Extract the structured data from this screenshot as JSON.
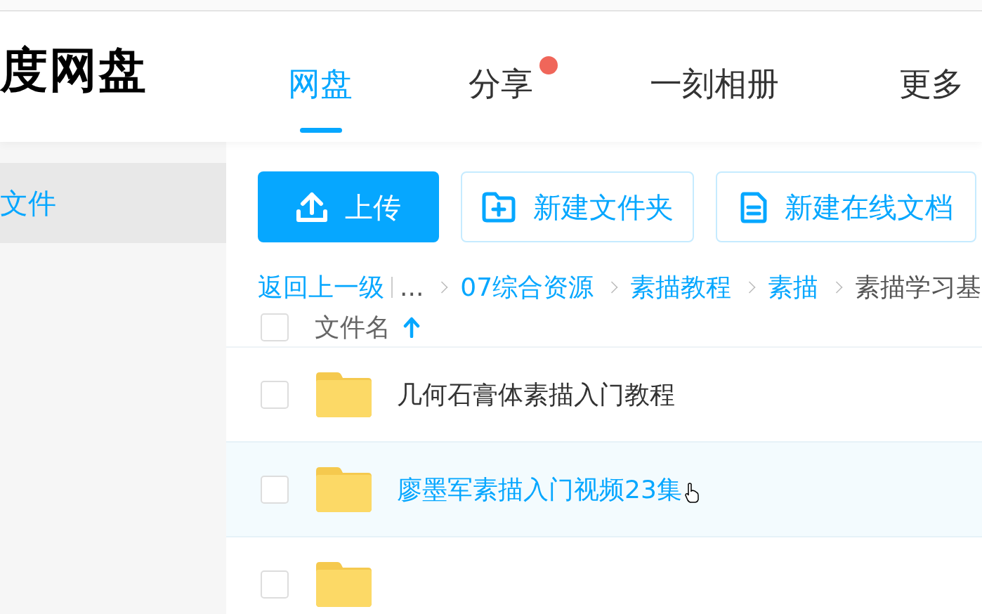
{
  "logo": "度网盘",
  "nav_tabs": [
    {
      "label": "网盘",
      "selected": true,
      "badge": false
    },
    {
      "label": "分享",
      "selected": false,
      "badge": true
    },
    {
      "label": "一刻相册",
      "selected": false,
      "badge": false
    },
    {
      "label": "更多",
      "selected": false,
      "badge": false
    }
  ],
  "sidebar": {
    "items": [
      {
        "label": "文件",
        "selected": true
      }
    ]
  },
  "toolbar": {
    "buttons": [
      {
        "kind": "upload",
        "label": "上传"
      },
      {
        "kind": "new-folder",
        "label": "新建文件夹"
      },
      {
        "kind": "new-doc",
        "label": "新建在线文档"
      }
    ]
  },
  "breadcrumb": {
    "back": "返回上一级",
    "ellipsis": "...",
    "path": [
      {
        "label": "07综合资源",
        "current": false
      },
      {
        "label": "素描教程",
        "current": false
      },
      {
        "label": "素描",
        "current": false
      },
      {
        "label": "素描学习基",
        "current": true
      }
    ]
  },
  "table": {
    "header": {
      "label": "文件名",
      "checked": false
    },
    "rows": [
      {
        "kind": "folder",
        "name": "几何石膏体素描入门教程",
        "hovered": false,
        "checked": false
      },
      {
        "kind": "folder",
        "name": "廖墨军素描入门视频23集",
        "hovered": true,
        "checked": false
      },
      {
        "kind": "folder",
        "hovered": false,
        "checked": false
      }
    ]
  }
}
